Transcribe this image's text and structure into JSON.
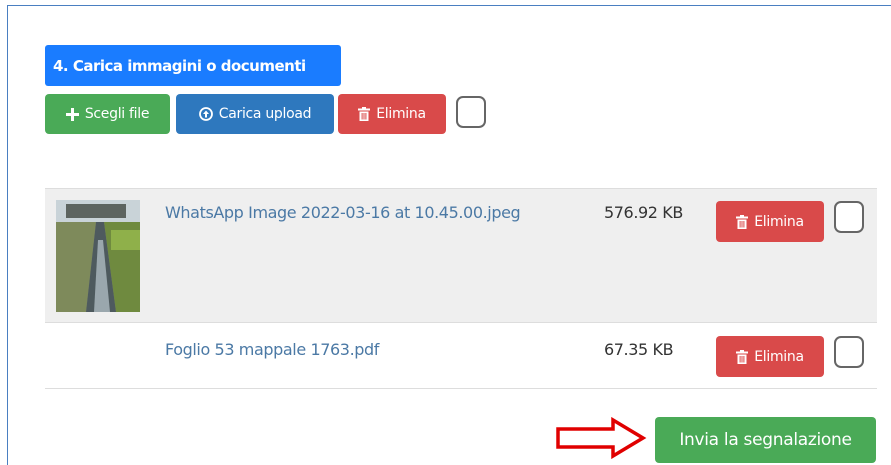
{
  "section": {
    "title": "4. Carica immagini o documenti"
  },
  "toolbar": {
    "choose_label": "Scegli file",
    "upload_label": "Carica upload",
    "delete_label": "Elimina"
  },
  "files": [
    {
      "name": "WhatsApp Image 2022-03-16 at 10.45.00.jpeg",
      "size": "576.92 KB",
      "delete_label": "Elimina"
    },
    {
      "name": "Foglio 53 mappale 1763.pdf",
      "size": "67.35 KB",
      "delete_label": "Elimina"
    }
  ],
  "submit": {
    "label": "Invia la segnalazione"
  },
  "colors": {
    "title_bg": "#1a7cff",
    "green": "#4aaa57",
    "blue": "#2e78be",
    "red": "#d94a4a",
    "link": "#4b79a5",
    "arrow": "#e00000"
  },
  "icons": {
    "choose": "plus-icon",
    "upload": "upload-circle-icon",
    "delete": "trash-icon",
    "annotation": "right-arrow-icon"
  }
}
